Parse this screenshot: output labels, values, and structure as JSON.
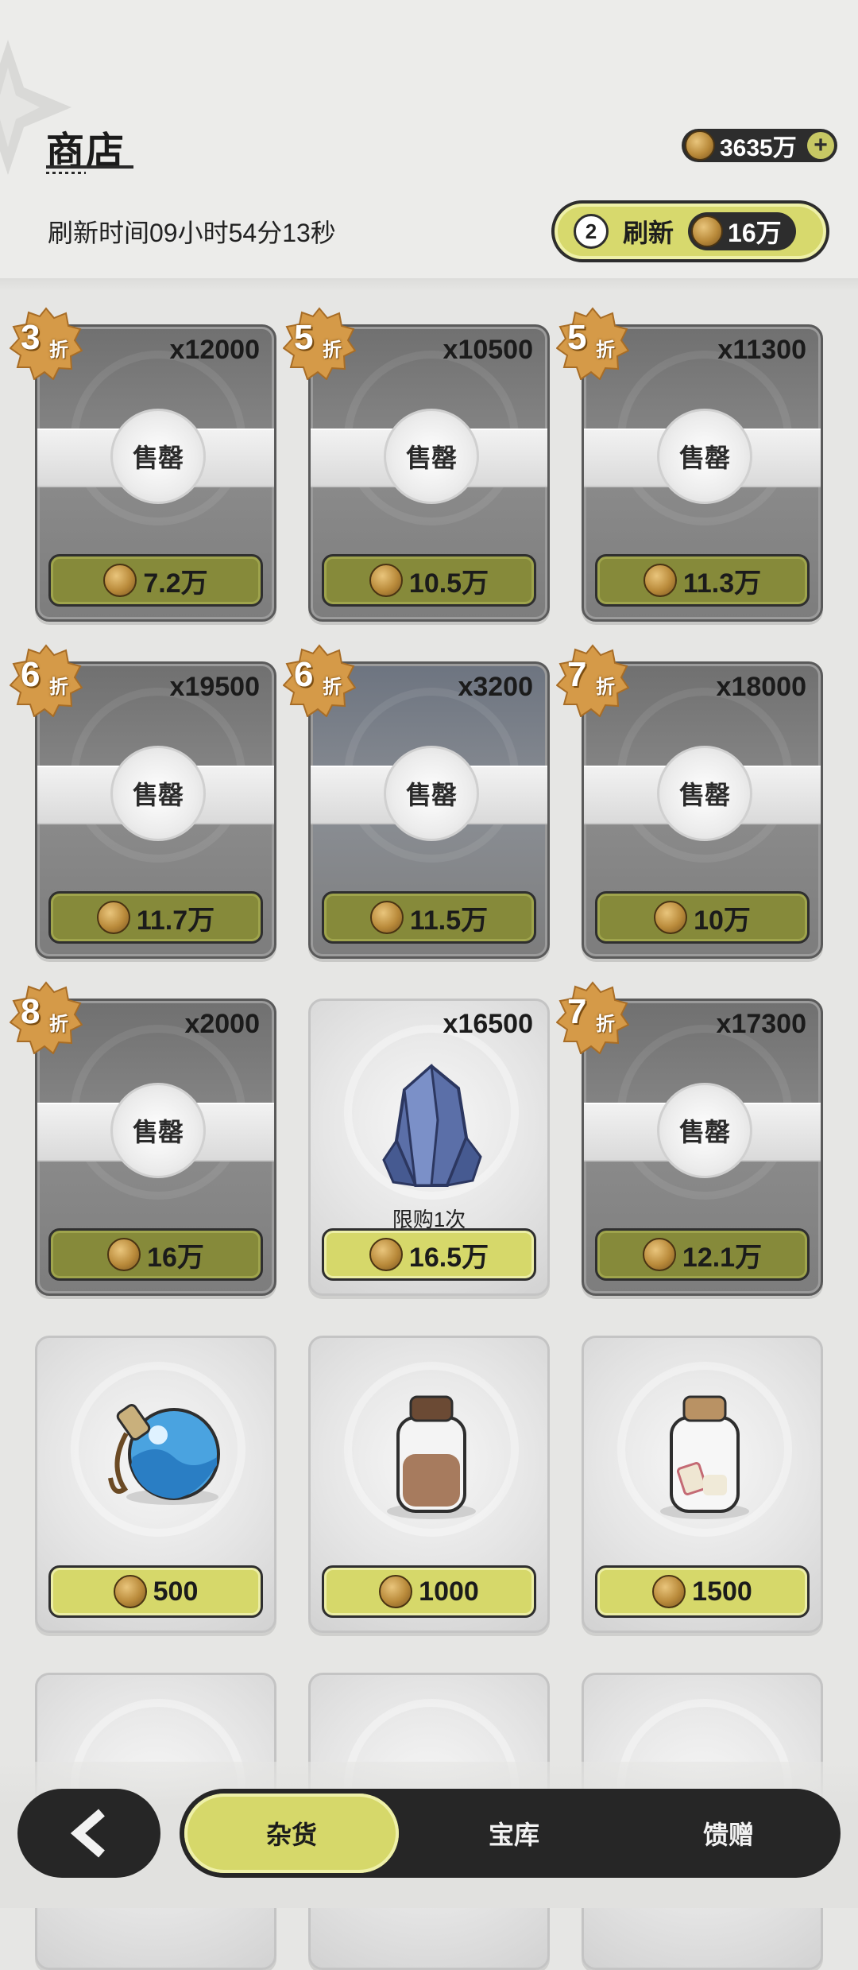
{
  "header": {
    "title": "商店",
    "refresh_time": "刷新时间09小时54分13秒",
    "currency_amount": "3635万",
    "plus_symbol": "+",
    "refresh_button": {
      "count": "2",
      "label": "刷新",
      "cost": "16万"
    }
  },
  "items": [
    {
      "qty": "x12000",
      "discount": "3",
      "sold_label": "售罄",
      "price": "7.2万"
    },
    {
      "qty": "x10500",
      "discount": "5",
      "sold_label": "售罄",
      "price": "10.5万"
    },
    {
      "qty": "x11300",
      "discount": "5",
      "sold_label": "售罄",
      "price": "11.3万"
    },
    {
      "qty": "x19500",
      "discount": "6",
      "sold_label": "售罄",
      "price": "11.7万"
    },
    {
      "qty": "x3200",
      "discount": "6",
      "sold_label": "售罄",
      "price": "11.5万"
    },
    {
      "qty": "x18000",
      "discount": "7",
      "sold_label": "售罄",
      "price": "10万"
    },
    {
      "qty": "x2000",
      "discount": "8",
      "sold_label": "售罄",
      "price": "16万"
    },
    {
      "qty": "x16500",
      "limit": "限购1次",
      "price": "16.5万"
    },
    {
      "qty": "x17300",
      "discount": "7",
      "sold_label": "售罄",
      "price": "12.1万"
    },
    {
      "price": "500"
    },
    {
      "price": "1000"
    },
    {
      "price": "1500"
    }
  ],
  "discount_suffix": "折",
  "tabs": [
    {
      "label": "杂货",
      "active": true
    },
    {
      "label": "宝库"
    },
    {
      "label": "馈赠"
    }
  ],
  "icons": {
    "back": "chevron-left-icon",
    "coin": "coin-icon"
  },
  "colors": {
    "accent": "#d6d86a",
    "dark": "#262626",
    "badge": "#d59a48"
  }
}
